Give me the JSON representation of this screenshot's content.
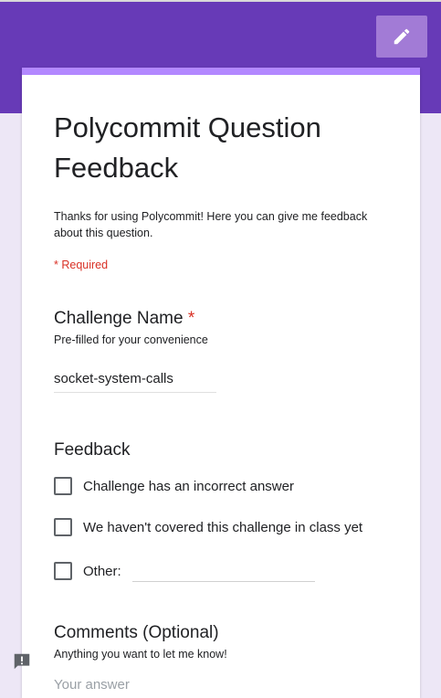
{
  "header": {
    "accent_color": "#673ab7",
    "edit_icon": "pencil-icon"
  },
  "form": {
    "title": "Polycommit Question Feedback",
    "description": "Thanks for using Polycommit! Here you can give me feedback about this question.",
    "required_note": "* Required"
  },
  "questions": {
    "challenge": {
      "title": "Challenge Name",
      "required_mark": "*",
      "help": "Pre-filled for your convenience",
      "value": "socket-system-calls"
    },
    "feedback": {
      "title": "Feedback",
      "options": [
        {
          "label": "Challenge has an incorrect answer",
          "checked": false
        },
        {
          "label": "We haven't covered this challenge in class yet",
          "checked": false
        },
        {
          "label": "Other:",
          "checked": false
        }
      ]
    },
    "comments": {
      "title": "Comments (Optional)",
      "help": "Anything you want to let me know!",
      "placeholder": "Your answer"
    }
  },
  "feedback_button": {
    "icon": "report-feedback-icon"
  }
}
